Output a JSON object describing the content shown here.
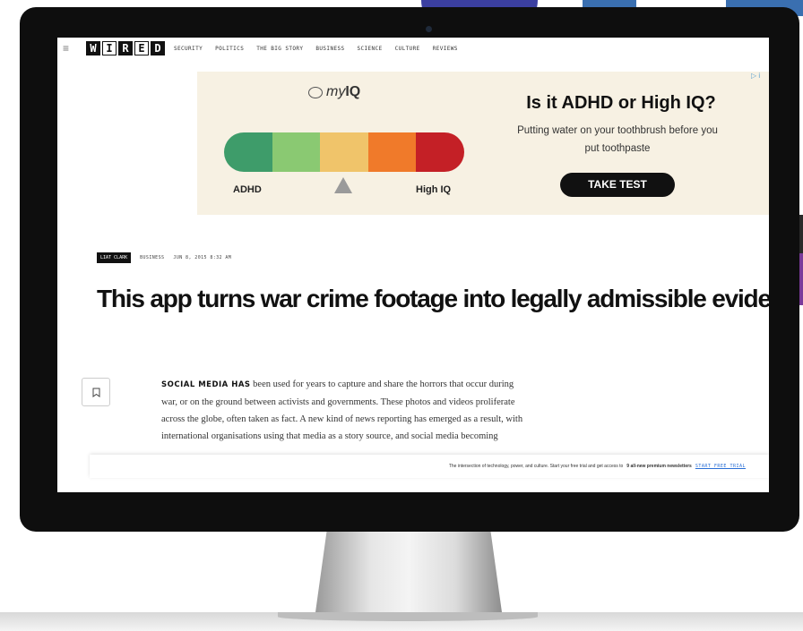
{
  "nav": {
    "menu_icon": "≡",
    "logo": [
      "W",
      "I",
      "R",
      "E",
      "D"
    ],
    "items": [
      "SECURITY",
      "POLITICS",
      "THE BIG STORY",
      "BUSINESS",
      "SCIENCE",
      "CULTURE",
      "REVIEWS"
    ]
  },
  "ad": {
    "marker": "▷ i",
    "brand_my": "my",
    "brand_iq": "IQ",
    "meter_colors": [
      "#3e9c6a",
      "#8ac972",
      "#f0c46a",
      "#f07a2a",
      "#c42026"
    ],
    "label_left": "ADHD",
    "label_right": "High IQ",
    "headline": "Is it ADHD or High IQ?",
    "subtext": "Putting water on your toothbrush before you put toothpaste",
    "button": "TAKE TEST"
  },
  "article": {
    "author": "LIAT CLARK",
    "category": "BUSINESS",
    "date": "JUN 8, 2015 8:32 AM",
    "headline": "This app turns war crime footage into legally admissible evidence",
    "lead": "SOCIAL MEDIA HAS",
    "body": "been used for years to capture and share the horrors that occur during war, or on the ground between activists and governments. These photos and videos proliferate across the globe, often taken as fact. A new kind of news reporting has emerged as a result, with international organisations using that media as a story source, and social media becoming"
  },
  "promo": {
    "text": "The intersection of technology, power, and culture. Start your free trial and get access to",
    "bold": "9 all-new premium newsletters",
    "cta": "START FREE TRIAL"
  }
}
